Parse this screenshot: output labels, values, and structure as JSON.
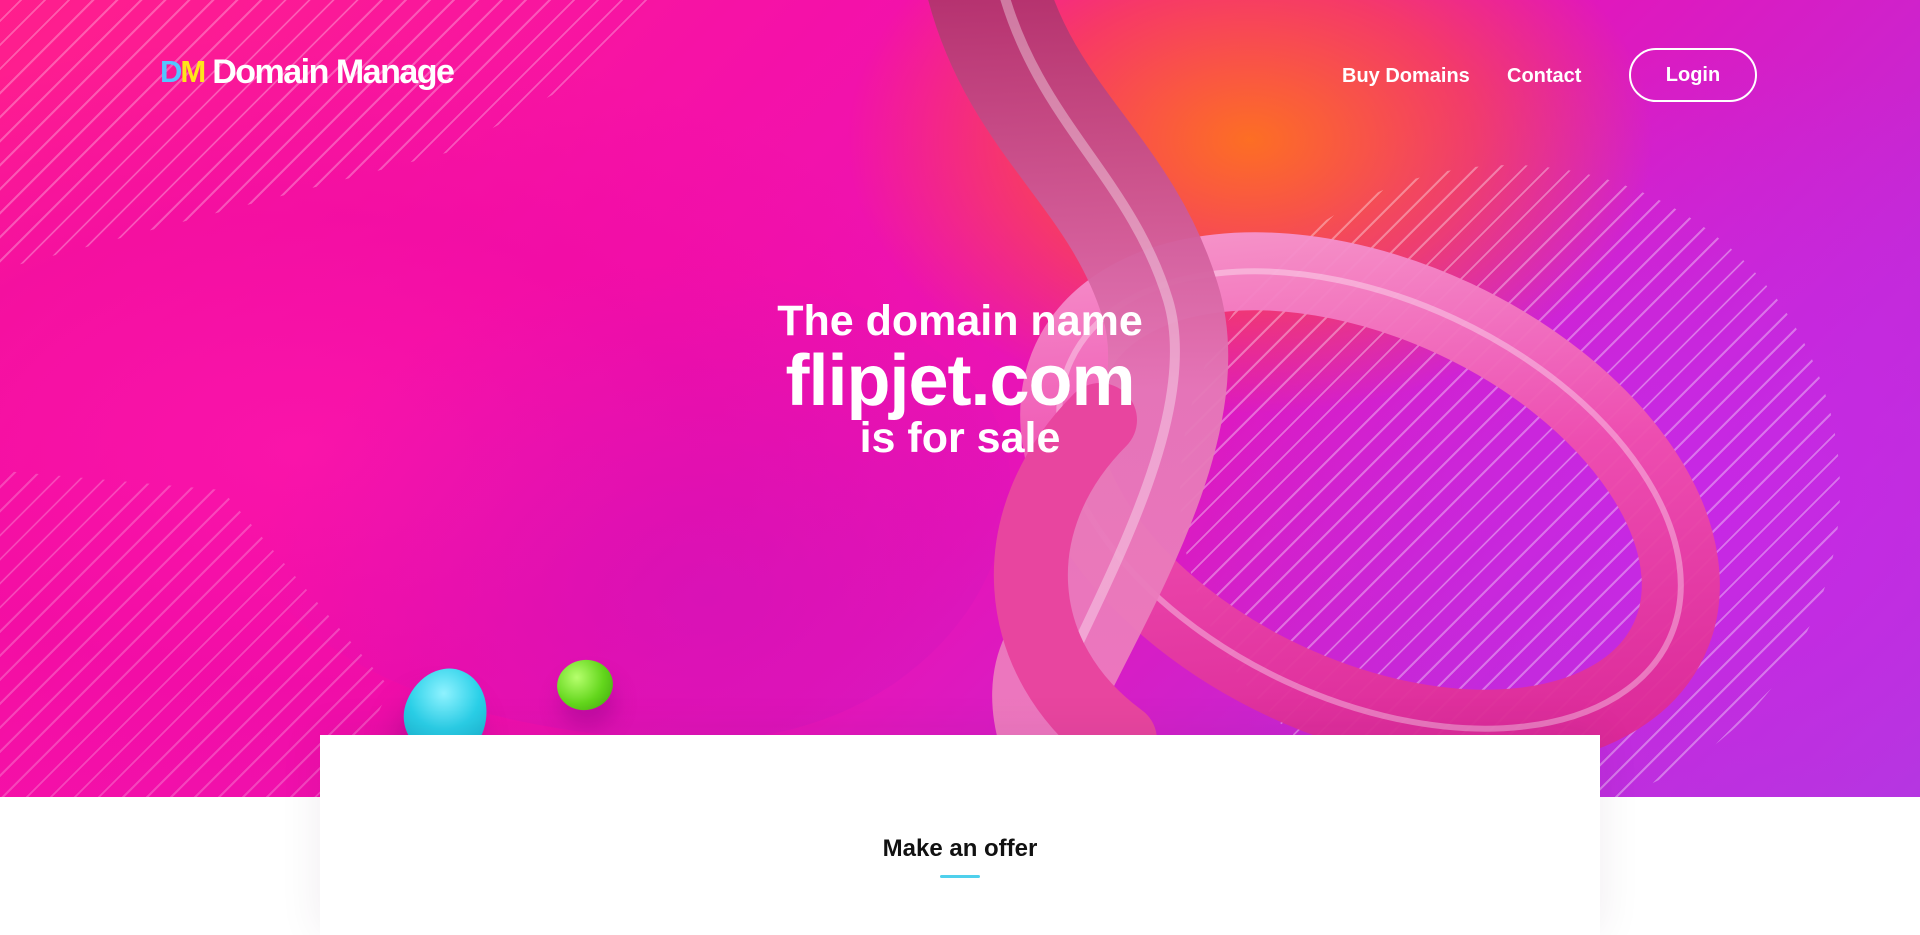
{
  "header": {
    "logo_mark_d": "D",
    "logo_mark_m": "M",
    "logo_text": "Domain Manage",
    "nav": [
      {
        "label": "Buy Domains"
      },
      {
        "label": "Contact"
      }
    ],
    "login_label": "Login"
  },
  "hero": {
    "line1": "The domain name",
    "domain": "flipjet.com",
    "line3": "is for sale"
  },
  "offer": {
    "title": "Make an offer"
  },
  "colors": {
    "hero_pink": "#f511a8",
    "hero_purple": "#b03ae0",
    "accent_cyan": "#4fd0ec",
    "logo_blue": "#54c6ff",
    "logo_yellow": "#ffe51a"
  }
}
